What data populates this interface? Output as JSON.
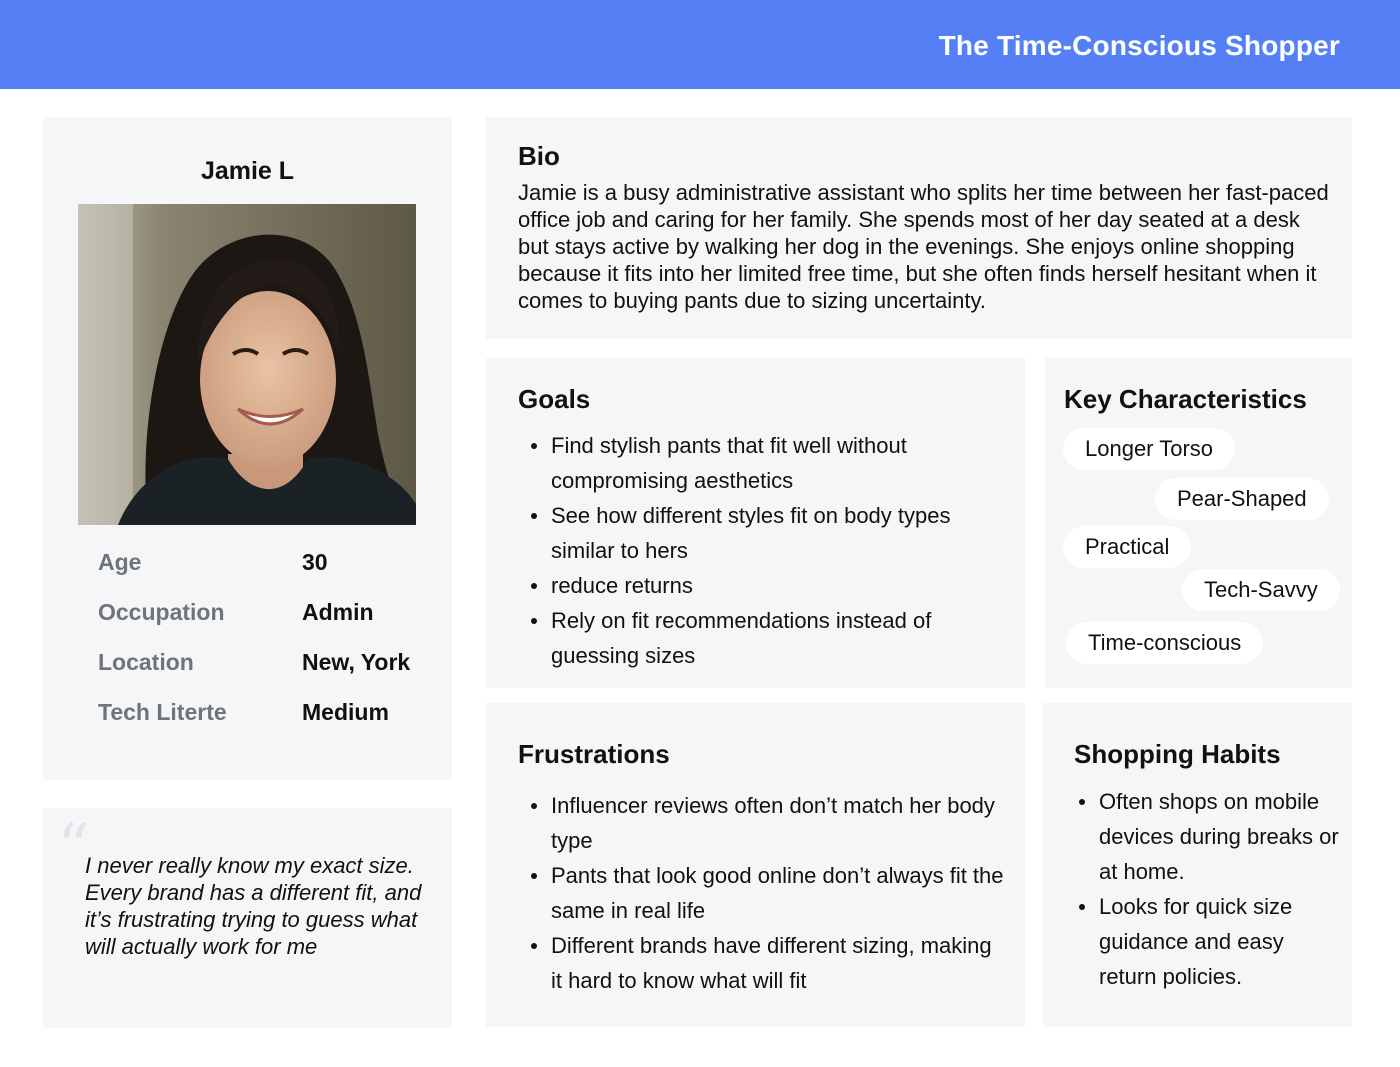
{
  "header": {
    "title": "The Time-Conscious Shopper"
  },
  "profile": {
    "name": "Jamie L",
    "info": [
      {
        "label": "Age",
        "value": "30"
      },
      {
        "label": "Occupation",
        "value": "Admin"
      },
      {
        "label": "Location",
        "value": "New, York"
      },
      {
        "label": "Tech Literte",
        "value": "Medium"
      }
    ]
  },
  "quote": {
    "mark": "“",
    "text": "I never really know my exact size. Every brand has a different fit, and it’s frustrating trying to guess what will actually work for me"
  },
  "bio": {
    "title": "Bio",
    "text": "Jamie is a busy administrative assistant who splits her time between her fast-paced office job and caring for her family. She spends most of her day seated at a desk but stays active by walking her dog in the evenings. She enjoys online shopping because it fits into her limited free time, but she often finds herself hesitant when it comes to buying pants due to sizing uncertainty."
  },
  "goals": {
    "title": "Goals",
    "items": [
      "Find stylish pants that fit well without compromising aesthetics",
      "See how different styles fit on body types similar to hers",
      "reduce returns",
      "Rely on fit recommendations instead of guessing sizes"
    ]
  },
  "characteristics": {
    "title": "Key Characteristics",
    "tags": [
      "Longer Torso",
      "Pear-Shaped",
      "Practical",
      "Tech-Savvy",
      "Time-conscious"
    ]
  },
  "frustrations": {
    "title": "Frustrations",
    "items": [
      "Influencer reviews often don’t match her body type",
      "Pants that look good online don’t always fit the same in real life",
      "Different brands have different sizing, making it hard to know what will fit"
    ]
  },
  "habits": {
    "title": "Shopping Habits",
    "items": [
      "Often shops on mobile devices during breaks or at home.",
      "Looks for quick size guidance and easy return policies."
    ]
  },
  "colors": {
    "header": "#5580F5",
    "card": "#F5F6F8",
    "label": "#707478"
  }
}
